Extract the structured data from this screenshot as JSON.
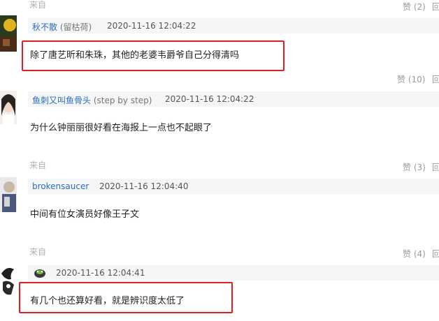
{
  "comments": [
    {
      "source": "来自",
      "likes": "赞 (2)",
      "reply": "回",
      "username": "秋不散",
      "user_note": "(留枯荷)",
      "timestamp": "2020-11-16 12:04:22",
      "body": "除了唐艺昕和朱珠，其他的老婆韦爵爷自己分得清吗",
      "highlighted": true
    },
    {
      "source": "",
      "likes": "赞 (10)",
      "reply": "回",
      "username": "鱼刺又叫鱼骨头",
      "user_note": "(step by step)",
      "timestamp": "2020-11-16 12:04:22",
      "body": "为什么钟丽丽很好看在海报上一点也不起眼了",
      "highlighted": false
    },
    {
      "source": "来自",
      "likes": "赞 (3)",
      "reply": "回",
      "username": "brokensaucer",
      "user_note": "",
      "timestamp": "2020-11-16 12:04:40",
      "body": "中间有位女演员好像王子文",
      "highlighted": false
    },
    {
      "source": "来自",
      "likes": "赞 (4)",
      "reply": "回",
      "username": "",
      "user_note": "",
      "timestamp": "2020-11-16 12:04:41",
      "body": "有几个也还算好看，就是辨识度太低了",
      "highlighted": true
    }
  ],
  "colors": {
    "highlight": "#e02020",
    "username": "#2a6fb8",
    "meta_bar": "#f4f6f8"
  }
}
